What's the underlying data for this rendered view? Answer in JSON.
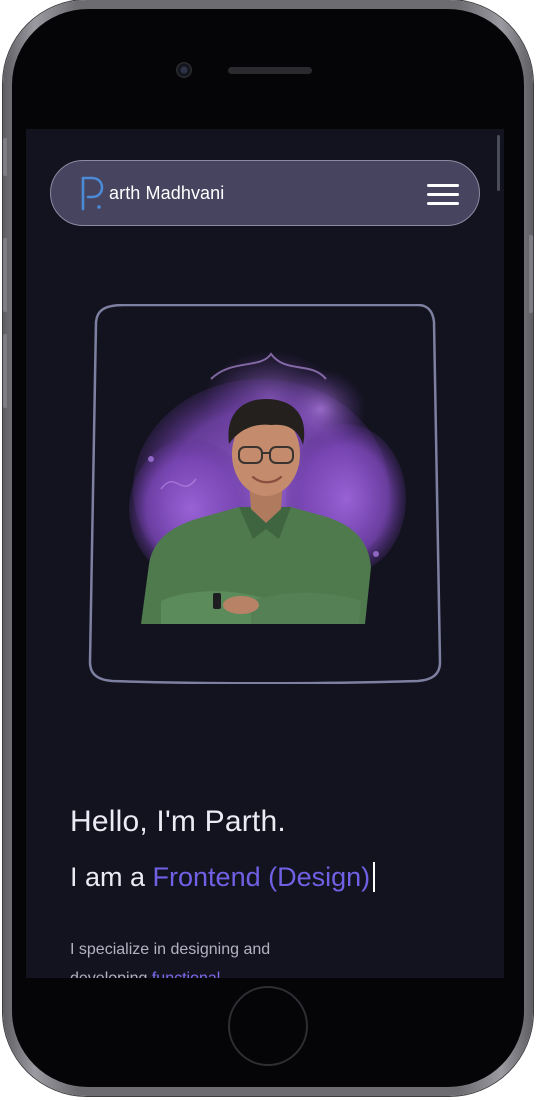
{
  "navbar": {
    "brand_name": "arth Madhvani",
    "logo_icon": "p-monogram-logo",
    "menu_icon": "hamburger-menu-icon"
  },
  "hero": {
    "portrait_icon": "profile-portrait"
  },
  "intro": {
    "greeting": "Hello, I'm Parth.",
    "role_prefix": "I am a ",
    "role_highlight": "Frontend (Design)",
    "description_start": "I specialize in designing and developing ",
    "description_highlight": "functional"
  },
  "colors": {
    "screen_bg": "#13131f",
    "navbar_bg": "#47445f",
    "accent": "#7060e4",
    "frame_stroke": "#7d80a0",
    "logo_blue": "#4a8ad6"
  }
}
